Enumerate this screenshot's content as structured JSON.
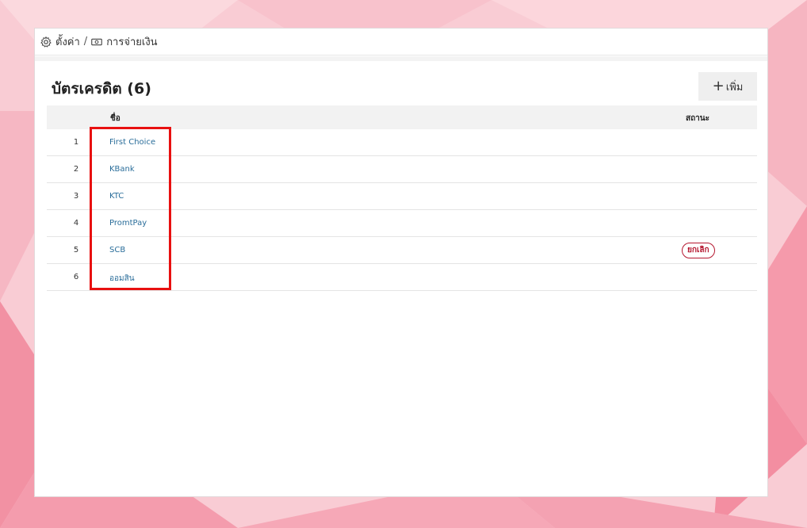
{
  "breadcrumb": {
    "items": [
      {
        "icon": "gear-icon",
        "label": "ตั้งค่า"
      },
      {
        "icon": "money-icon",
        "label": "การจ่ายเงิน"
      }
    ],
    "separator": "/"
  },
  "page": {
    "title": "บัตรเครดิต (6)",
    "add_button": {
      "icon": "plus",
      "label": "เพิ่ม"
    }
  },
  "table": {
    "columns": {
      "name": "ชื่อ",
      "status": "สถานะ"
    },
    "rows": [
      {
        "index": "1",
        "name": "First Choice",
        "status": ""
      },
      {
        "index": "2",
        "name": "KBank",
        "status": ""
      },
      {
        "index": "3",
        "name": "KTC",
        "status": ""
      },
      {
        "index": "4",
        "name": "PromtPay",
        "status": ""
      },
      {
        "index": "5",
        "name": "SCB",
        "status": "ยกเลิก"
      },
      {
        "index": "6",
        "name": "ออมสิน",
        "status": ""
      }
    ]
  },
  "colors": {
    "link": "#2a6d9a",
    "status_cancelled": "#b5172f",
    "highlight": "#e81010",
    "background": "#f7c7cf"
  }
}
